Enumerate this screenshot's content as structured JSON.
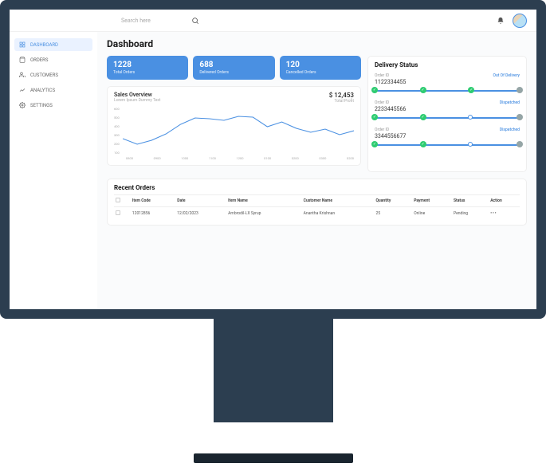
{
  "search": {
    "placeholder": "Search here"
  },
  "nav": {
    "items": [
      {
        "label": "DASHBOARD"
      },
      {
        "label": "ORDERS"
      },
      {
        "label": "CUSTOMERS"
      },
      {
        "label": "ANALYTICS"
      },
      {
        "label": "SETTINGS"
      }
    ]
  },
  "page_title": "Dashboard",
  "stats": [
    {
      "value": "1228",
      "label": "Total Orders"
    },
    {
      "value": "688",
      "label": "Delivered Orders"
    },
    {
      "value": "120",
      "label": "Cancelled Orders"
    }
  ],
  "delivery": {
    "title": "Delivery Status",
    "order_id_label": "Order ID",
    "items": [
      {
        "id": "1122334455",
        "status": "Out Of Delivery"
      },
      {
        "id": "2233445566",
        "status": "Dispatched"
      },
      {
        "id": "3344556677",
        "status": "Dispatched"
      }
    ]
  },
  "chart": {
    "title": "Sales Overview",
    "subtitle": "Lorem Ipsum Dummy Text",
    "total_value": "$ 12,453",
    "total_label": "Total Profit"
  },
  "chart_data": {
    "type": "line",
    "title": "Sales Overview",
    "xlabel": "",
    "ylabel": "",
    "ylim": [
      0,
      600
    ],
    "x": [
      "0800",
      "0900",
      "1000",
      "1100",
      "1200",
      "0100",
      "0200",
      "0300",
      "0200"
    ],
    "y_ticks": [
      600,
      500,
      400,
      300,
      200,
      100
    ],
    "values": [
      200,
      130,
      180,
      260,
      380,
      460,
      450,
      430,
      480,
      470,
      350,
      410,
      330,
      280,
      320,
      250,
      300
    ]
  },
  "recent": {
    "title": "Recent Orders",
    "columns": [
      "Item Code",
      "Date",
      "Item Name",
      "Customer Name",
      "Quantity",
      "Payment",
      "Status",
      "Action"
    ],
    "rows": [
      {
        "code": "12012856",
        "date": "12/02/2023",
        "item": "Ambrodil-LX Syrup",
        "customer": "Anantha Krishnan",
        "qty": "25",
        "payment": "Online",
        "status": "Pending"
      }
    ]
  }
}
